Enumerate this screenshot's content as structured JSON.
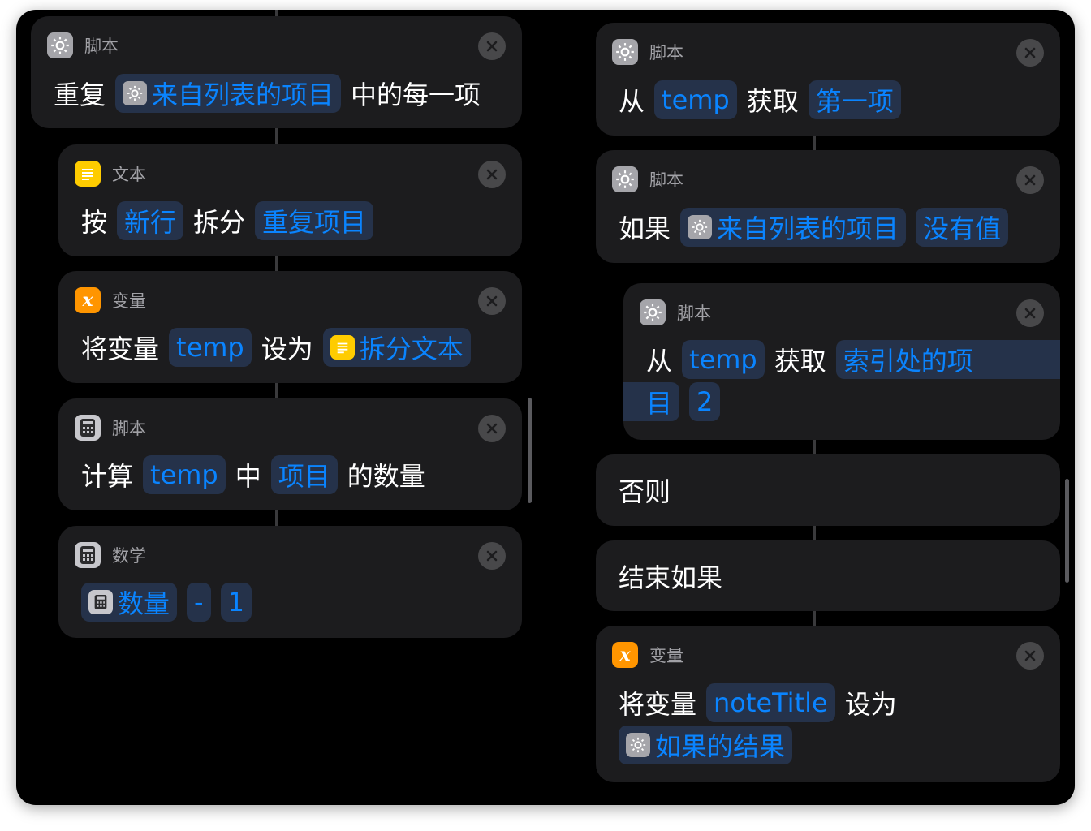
{
  "left_column": {
    "repeat_card": {
      "app": "脚本",
      "parts": [
        "重复",
        "来自列表的项目",
        "中的每一项"
      ]
    },
    "split_card": {
      "app": "文本",
      "parts": [
        "按",
        "新行",
        "拆分",
        "重复项目"
      ]
    },
    "setvar_card": {
      "app": "变量",
      "parts": [
        "将变量",
        "temp",
        "设为",
        "拆分文本"
      ]
    },
    "count_card": {
      "app": "脚本",
      "parts": [
        "计算",
        "temp",
        "中",
        "项目",
        "的数量"
      ]
    },
    "math_card": {
      "app": "数学",
      "parts": [
        "数量",
        "-",
        "1"
      ]
    }
  },
  "right_column": {
    "getfirst_card": {
      "app": "脚本",
      "parts": [
        "从",
        "temp",
        "获取",
        "第一项"
      ]
    },
    "if_card": {
      "app": "脚本",
      "parts": [
        "如果",
        "来自列表的项目",
        "没有值"
      ]
    },
    "getindex_card": {
      "app": "脚本",
      "parts": [
        "从",
        "temp",
        "获取",
        "索引处的项",
        "目",
        "2"
      ]
    },
    "otherwise_card": {
      "label": "否则"
    },
    "endif_card": {
      "label": "结束如果"
    },
    "setvar2_card": {
      "app": "变量",
      "parts": [
        "将变量",
        "noteTitle",
        "设为",
        "如果的结果"
      ]
    }
  },
  "colors": {
    "background": "#000000",
    "card": "#1c1c1e",
    "token_text": "#0a84ff",
    "token_bg": "#25324a",
    "secondary_text": "#a1a1a6"
  },
  "icons": {
    "script": "gear-icon",
    "text": "text-lines-icon",
    "variable": "variable-x-icon",
    "calc": "calculator-icon",
    "close": "close-icon"
  }
}
